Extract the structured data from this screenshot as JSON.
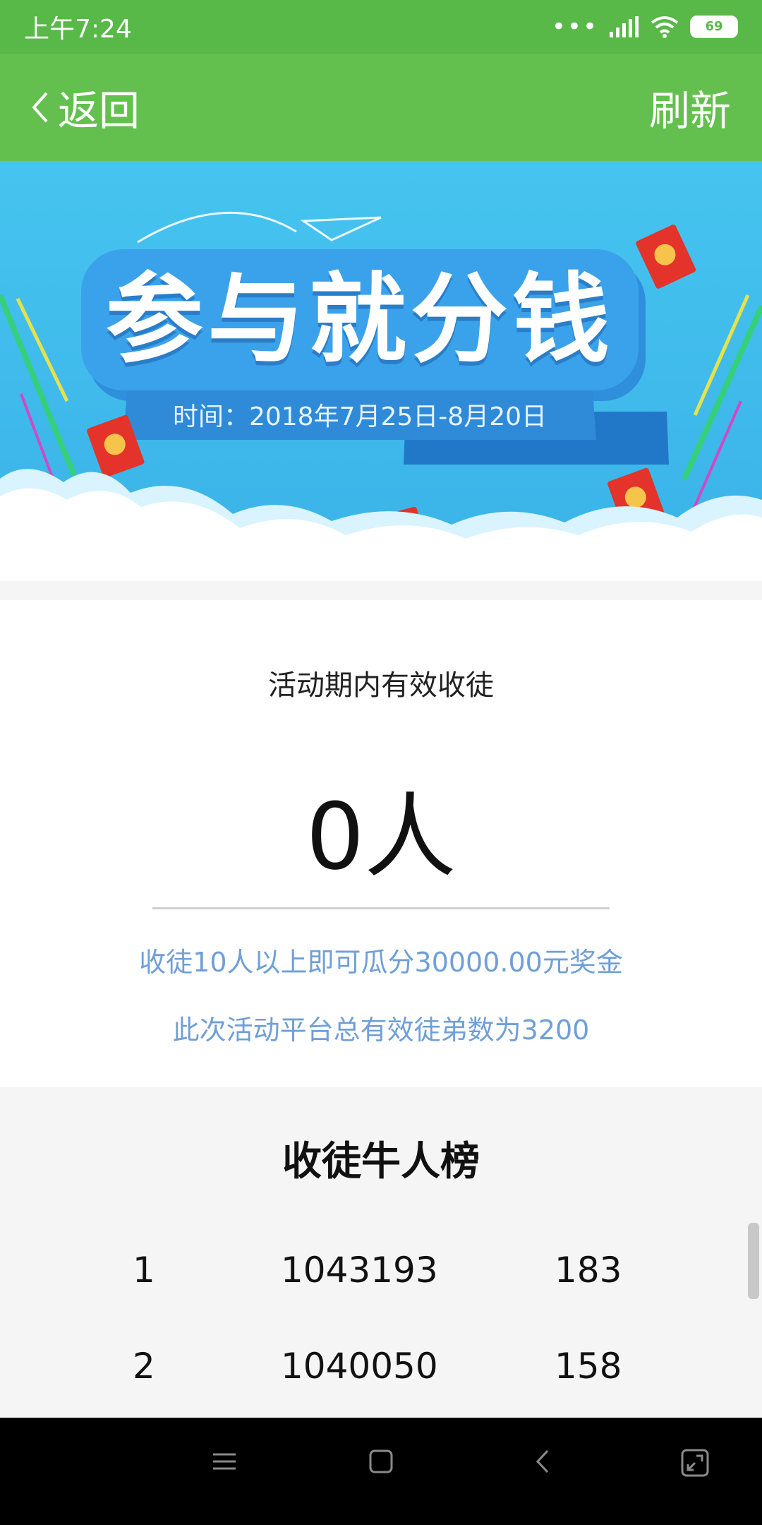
{
  "status_bar": {
    "time": "上午7:24",
    "battery": "69"
  },
  "title_bar": {
    "back_label": "返回",
    "refresh_label": "刷新"
  },
  "banner": {
    "headline": "参与就分钱",
    "date_range": "时间：2018年7月25日-8月20日"
  },
  "stats": {
    "label": "活动期内有效收徒",
    "count": "0人",
    "note_reward": "收徒10人以上即可瓜分30000.00元奖金",
    "note_total": "此次活动平台总有效徒弟数为3200"
  },
  "ranking": {
    "title": "收徒牛人榜",
    "rows": [
      {
        "rank": "1",
        "user_id": "1043193",
        "count": "183"
      },
      {
        "rank": "2",
        "user_id": "1040050",
        "count": "158"
      }
    ]
  },
  "colors": {
    "status_bar": "#58b848",
    "title_bar": "#63c04e",
    "banner_blue": "#46c4ef",
    "note_text": "#6f9fd8"
  },
  "icons": [
    "back-chevron-icon",
    "signal-icon",
    "wifi-icon",
    "battery-icon",
    "menu-icon",
    "home-icon",
    "back-icon",
    "recents-icon"
  ]
}
